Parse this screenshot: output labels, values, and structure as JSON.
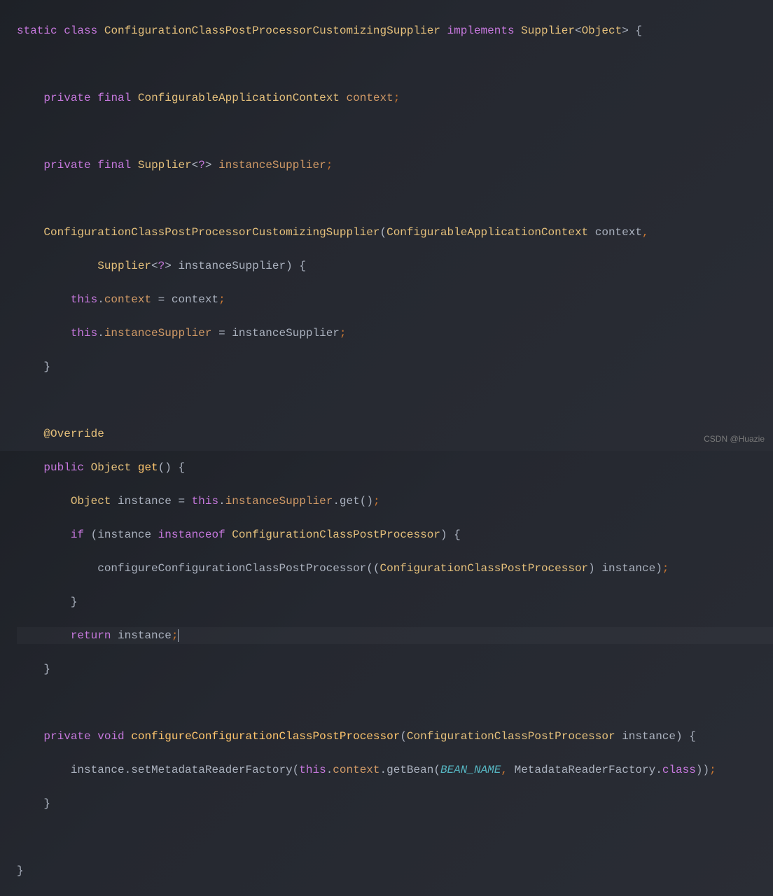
{
  "watermark": "CSDN @Huazie",
  "code": {
    "line1": {
      "static": "static",
      "class": "class",
      "className": "ConfigurationClassPostProcessorCustomizingSupplier",
      "implements": "implements",
      "supplier": "Supplier",
      "object": "Object",
      "openBrace": "{"
    },
    "line3": {
      "private": "private",
      "final": "final",
      "type": "ConfigurableApplicationContext",
      "field": "context",
      "semi": ";"
    },
    "line5": {
      "private": "private",
      "final": "final",
      "type": "Supplier",
      "wildcard": "?",
      "field": "instanceSupplier",
      "semi": ";"
    },
    "line7": {
      "ctor": "ConfigurationClassPostProcessorCustomizingSupplier",
      "param1Type": "ConfigurableApplicationContext",
      "param1": "context"
    },
    "line8": {
      "type": "Supplier",
      "wildcard": "?",
      "param": "instanceSupplier",
      "openBrace": "{"
    },
    "line9": {
      "this": "this",
      "field": "context",
      "var": "context",
      "semi": ";"
    },
    "line10": {
      "this": "this",
      "field": "instanceSupplier",
      "var": "instanceSupplier",
      "semi": ";"
    },
    "line11": {
      "closeBrace": "}"
    },
    "line13": {
      "override": "@Override"
    },
    "line14": {
      "public": "public",
      "returnType": "Object",
      "method": "get",
      "openBrace": "{"
    },
    "line15": {
      "type": "Object",
      "var": "instance",
      "this": "this",
      "field": "instanceSupplier",
      "method": "get",
      "semi": ";"
    },
    "line16": {
      "if": "if",
      "var": "instance",
      "instanceof": "instanceof",
      "type": "ConfigurationClassPostProcessor",
      "openBrace": "{"
    },
    "line17": {
      "method": "configureConfigurationClassPostProcessor",
      "castType": "ConfigurationClassPostProcessor",
      "var": "instance",
      "semi": ";"
    },
    "line18": {
      "closeBrace": "}"
    },
    "line19": {
      "return": "return",
      "var": "instance",
      "semi": ";"
    },
    "line20": {
      "closeBrace": "}"
    },
    "line22": {
      "private": "private",
      "void": "void",
      "method": "configureConfigurationClassPostProcessor",
      "paramType": "ConfigurationClassPostProcessor",
      "param": "instance",
      "openBrace": "{"
    },
    "line23": {
      "var": "instance",
      "method1": "setMetadataReaderFactory",
      "this": "this",
      "field": "context",
      "method2": "getBean",
      "const": "BEAN_NAME",
      "type": "MetadataReaderFactory",
      "class": "class",
      "semi": ";"
    },
    "line24": {
      "closeBrace": "}"
    },
    "line26": {
      "closeBrace": "}"
    }
  }
}
